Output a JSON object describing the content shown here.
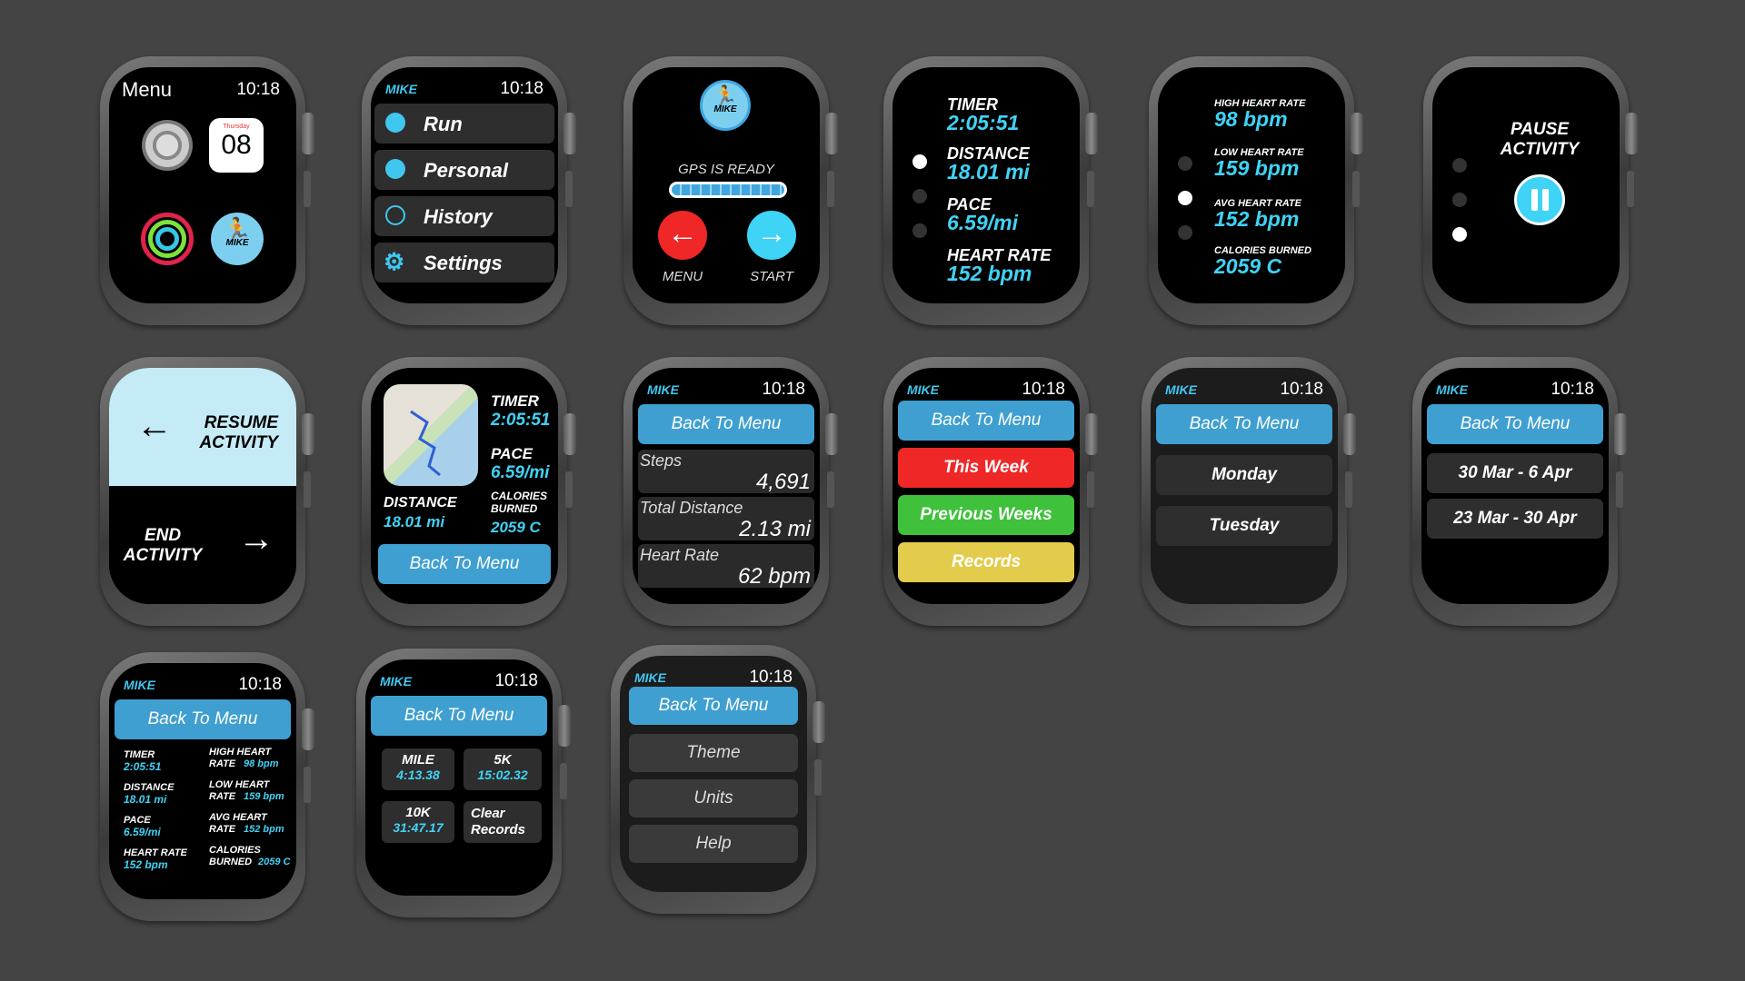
{
  "brand": "MIKE",
  "time": "10:18",
  "w1": {
    "title": "Menu",
    "date_day": "Thursday",
    "date_num": "08",
    "mike_logo": "MIKE"
  },
  "w2": {
    "items": [
      {
        "label": "Run",
        "icon": "stopwatch-icon"
      },
      {
        "label": "Personal",
        "icon": "person-icon"
      },
      {
        "label": "History",
        "icon": "clock-icon"
      },
      {
        "label": "Settings",
        "icon": "gear-icon"
      }
    ]
  },
  "w3": {
    "logo": "MIKE",
    "gps": "GPS IS READY",
    "menu": "MENU",
    "start": "START",
    "gps_progress": 1.0
  },
  "w4": {
    "timer_l": "TIMER",
    "timer_v": "2:05:51",
    "dist_l": "DISTANCE",
    "dist_v": "18.01 mi",
    "pace_l": "PACE",
    "pace_v": "6.59/mi",
    "hr_l": "HEART RATE",
    "hr_v": "152 bpm"
  },
  "w5": {
    "high_l": "HIGH HEART RATE",
    "high_v": "98 bpm",
    "low_l": "LOW HEART RATE",
    "low_v": "159 bpm",
    "avg_l": "AVG HEART RATE",
    "avg_v": "152 bpm",
    "cal_l": "CALORIES BURNED",
    "cal_v": "2059 C"
  },
  "w6": {
    "title": "PAUSE ACTIVITY"
  },
  "w7": {
    "resume": "RESUME ACTIVITY",
    "end": "END ACTIVITY"
  },
  "w8": {
    "timer_l": "TIMER",
    "timer_v": "2:05:51",
    "pace_l": "PACE",
    "pace_v": "6.59/mi",
    "dist_l": "DISTANCE",
    "dist_v": "18.01 mi",
    "cal_l": "CALORIES BURNED",
    "cal_v": "2059 C",
    "back": "Back To Menu"
  },
  "w9": {
    "back": "Back To Menu",
    "steps_l": "Steps",
    "steps_v": "4,691",
    "dist_l": "Total Distance",
    "dist_v": "2.13 mi",
    "hr_l": "Heart Rate",
    "hr_v": "62 bpm"
  },
  "w10": {
    "back": "Back To Menu",
    "week": "This Week",
    "prev": "Previous Weeks",
    "records": "Records"
  },
  "w11": {
    "back": "Back To Menu",
    "d1": "Monday",
    "d2": "Tuesday"
  },
  "w12": {
    "back": "Back To Menu",
    "r1": "30 Mar - 6 Apr",
    "r2": "23 Mar - 30 Apr"
  },
  "w13": {
    "back": "Back To Menu",
    "timer_l": "TIMER",
    "timer_v": "2:05:51",
    "dist_l": "DISTANCE",
    "dist_v": "18.01 mi",
    "pace_l": "PACE",
    "pace_v": "6.59/mi",
    "hr_l": "HEART RATE",
    "hr_v": "152 bpm",
    "high_l": "HIGH HEART RATE",
    "high_v": "98 bpm",
    "low_l": "LOW HEART RATE",
    "low_v": "159 bpm",
    "avg_l": "AVG HEART RATE",
    "avg_v": "152 bpm",
    "cal_l": "CALORIES BURNED",
    "cal_v": "2059 C"
  },
  "w14": {
    "back": "Back To Menu",
    "mile_l": "MILE",
    "mile_v": "4:13.38",
    "k5_l": "5K",
    "k5_v": "15:02.32",
    "k10_l": "10K",
    "k10_v": "31:47.17",
    "clear": "Clear Records"
  },
  "w15": {
    "back": "Back To Menu",
    "theme": "Theme",
    "units": "Units",
    "help": "Help"
  },
  "colors": {
    "background": "#444444",
    "accent_blue": "#3f9fd0",
    "cyan": "#3fd3f6",
    "red": "#f02727",
    "green": "#3fc13c",
    "yellow": "#e3cb4c"
  }
}
